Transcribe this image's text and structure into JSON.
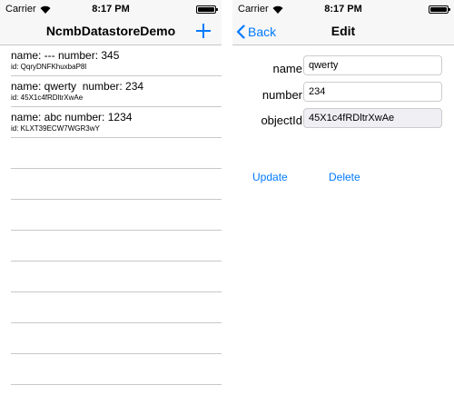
{
  "list_screen": {
    "status": {
      "carrier": "Carrier",
      "time": "8:17 PM"
    },
    "title": "NcmbDatastoreDemo",
    "items": [
      {
        "title": "name: --- number: 345",
        "id": "id: QqryDNFKhuxbaP8l"
      },
      {
        "title": "name: qwerty  number: 234",
        "id": "id: 45X1c4fRDltrXwAe"
      },
      {
        "title": "name: abc number: 1234",
        "id": "id: KLXT39ECW7WGR3wY"
      }
    ]
  },
  "edit_screen": {
    "status": {
      "carrier": "Carrier",
      "time": "8:17 PM"
    },
    "title": "Edit",
    "back_label": "Back",
    "fields": {
      "name": {
        "label": "name",
        "value": "qwerty"
      },
      "number": {
        "label": "number",
        "value": "234"
      },
      "objectId": {
        "label": "objectId",
        "value": "45X1c4fRDltrXwAe"
      }
    },
    "update_label": "Update",
    "delete_label": "Delete"
  },
  "colors": {
    "accent": "#007aff",
    "separator": "#c8c7cc",
    "bar": "#f7f7f7"
  }
}
